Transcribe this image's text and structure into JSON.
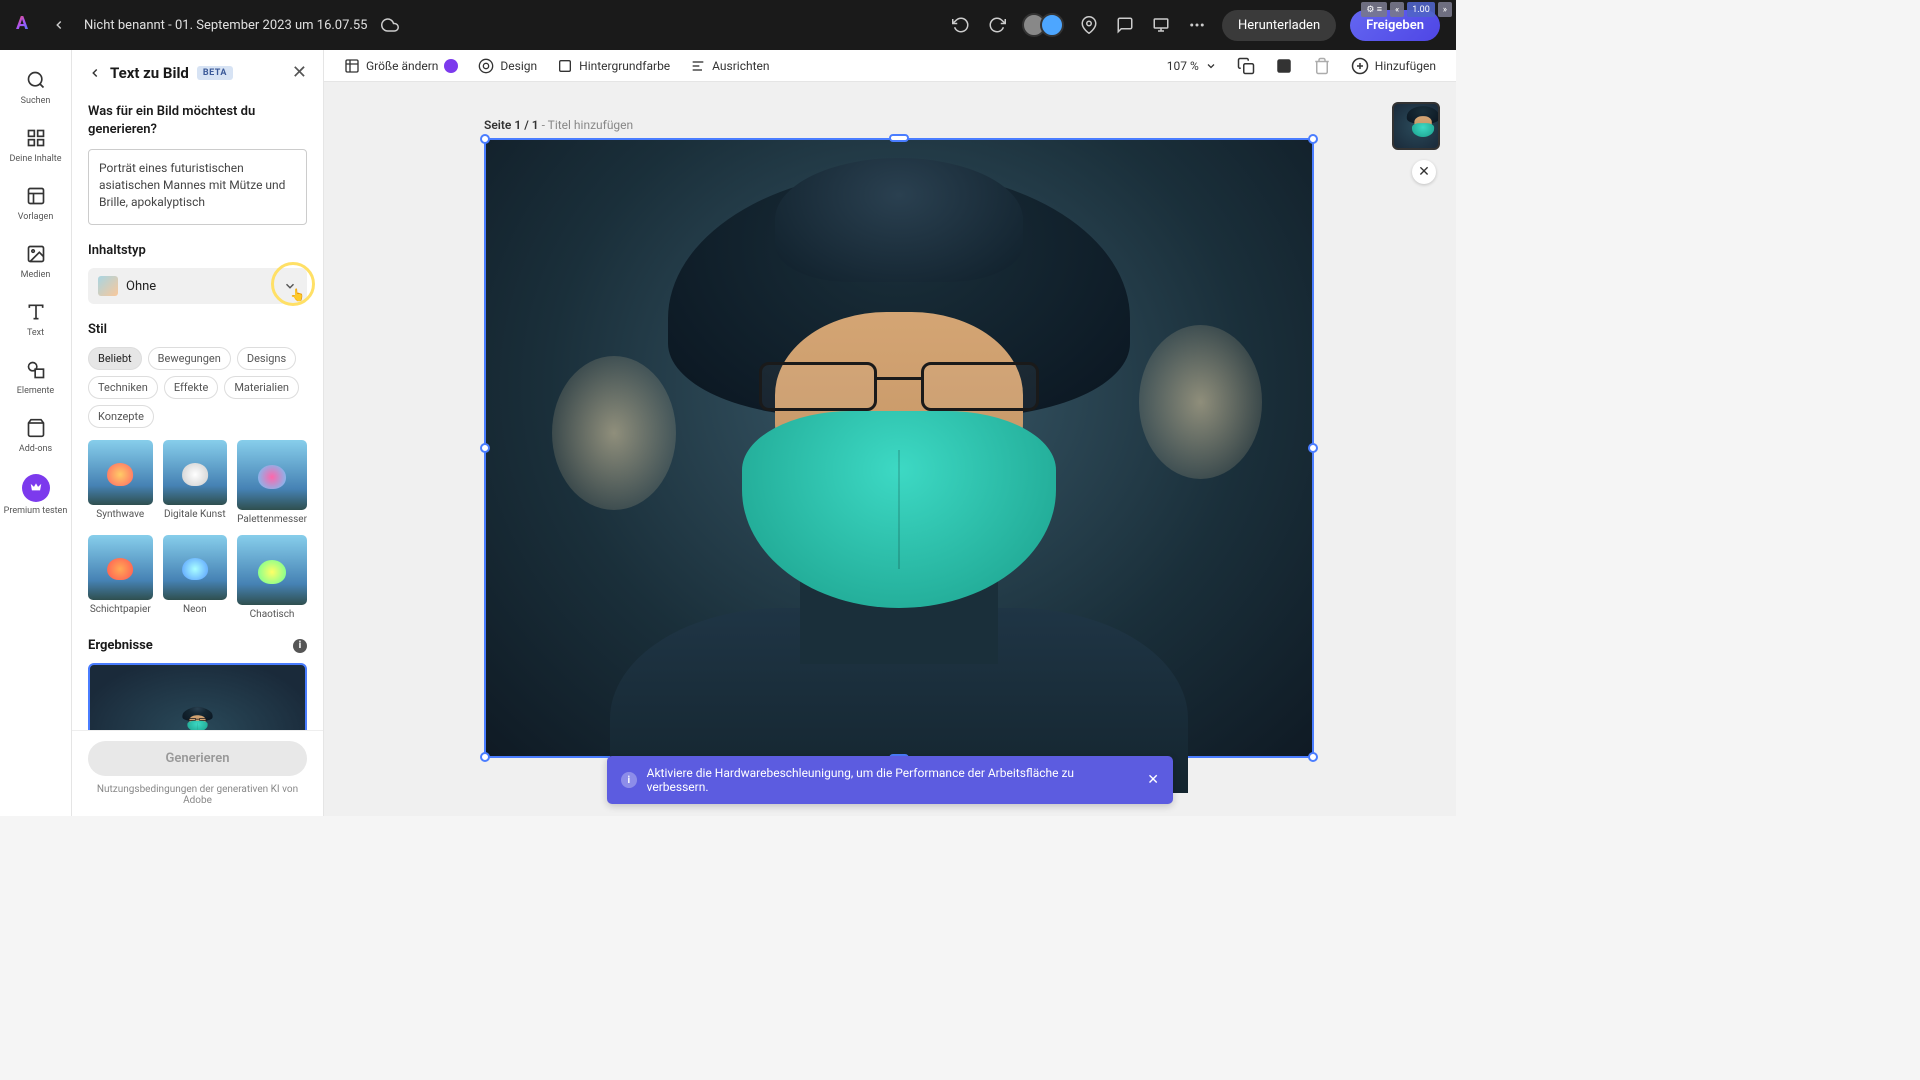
{
  "topbar": {
    "doc_title": "Nicht benannt - 01. September 2023 um 16.07.55",
    "download_label": "Herunterladen",
    "share_label": "Freigeben"
  },
  "rail": {
    "search": "Suchen",
    "your_content": "Deine Inhalte",
    "templates": "Vorlagen",
    "media": "Medien",
    "text": "Text",
    "elements": "Elemente",
    "addons": "Add-ons",
    "premium": "Premium testen"
  },
  "panel": {
    "title": "Text zu Bild",
    "beta": "BETA",
    "prompt_label": "Was für ein Bild möchtest du generieren?",
    "prompt_value": "Porträt eines futuristischen asiatischen Mannes mit Mütze und Brille, apokalyptisch",
    "content_type_label": "Inhaltstyp",
    "content_type_value": "Ohne",
    "style_label": "Stil",
    "chips": [
      "Beliebt",
      "Bewegungen",
      "Designs",
      "Techniken",
      "Effekte",
      "Materialien",
      "Konzepte"
    ],
    "styles": [
      "Synthwave",
      "Digitale Kunst",
      "Palettenmesser",
      "Schichtpapier",
      "Neon",
      "Chaotisch"
    ],
    "results_label": "Ergebnisse",
    "generate_label": "Generieren",
    "terms": "Nutzungsbedingungen der generativen KI von Adobe"
  },
  "toolbar": {
    "resize": "Größe ändern",
    "design": "Design",
    "bgcolor": "Hintergrundfarbe",
    "align": "Ausrichten",
    "zoom": "107 %",
    "add": "Hinzufügen"
  },
  "canvas": {
    "page_prefix": "Seite 1 / 1",
    "page_placeholder": "Titel hinzufügen"
  },
  "toast": {
    "message": "Aktiviere die Hardwarebeschleunigung, um die Performance der Arbeitsfläche zu verbessern."
  },
  "ext": {
    "speed": "1.00"
  }
}
